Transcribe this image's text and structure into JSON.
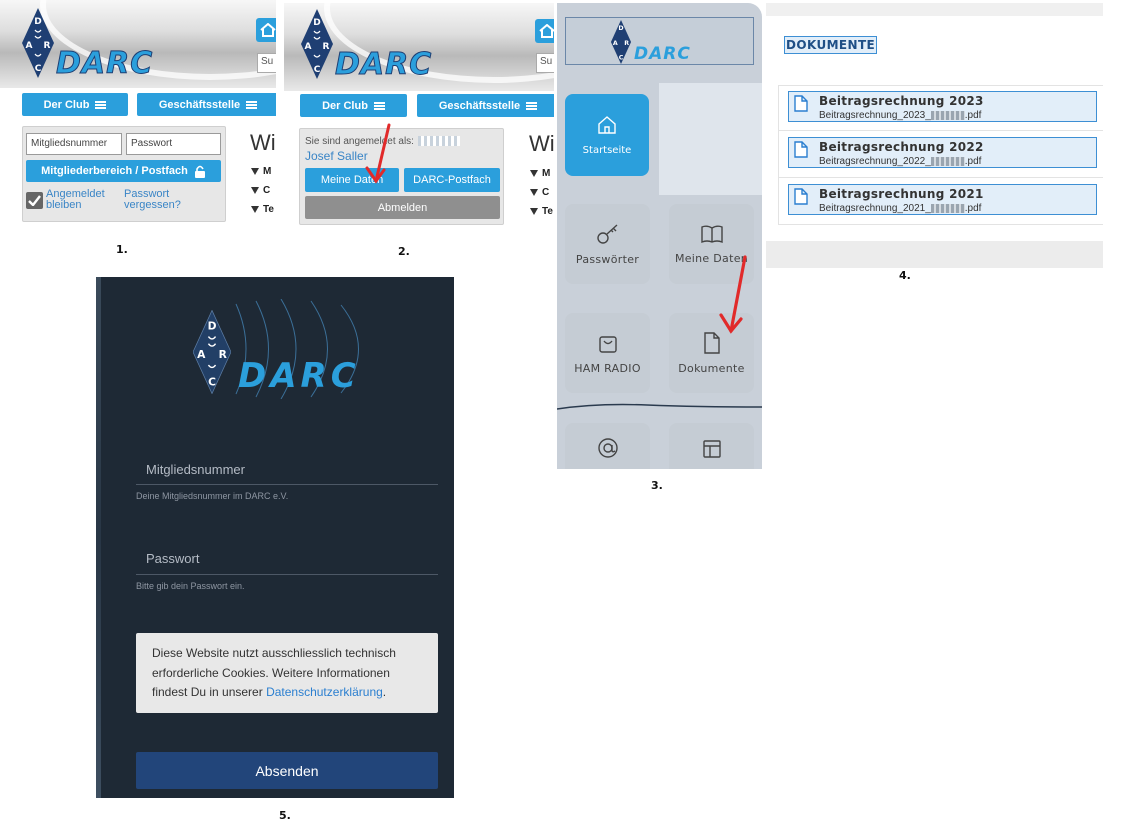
{
  "brand": {
    "logo_text": "DARC",
    "logo_letters": [
      "D",
      "A",
      "R",
      "C"
    ],
    "accent_color": "#2b9fdc"
  },
  "step_labels": [
    "1.",
    "2.",
    "3.",
    "4.",
    "5."
  ],
  "panel1": {
    "nav": {
      "club": "Der Club",
      "office": "Geschäftsstelle"
    },
    "search_partial": "Su",
    "member_number_placeholder": "Mitgliedsnummer",
    "password_placeholder": "Passwort",
    "login_button": "Mitgliederbereich / Postfach",
    "stay_logged_in_line1": "Angemeldet",
    "stay_logged_in_line2": "bleiben",
    "forgot_line1": "Passwort",
    "forgot_line2": "vergessen?",
    "heading_partial": "Wi",
    "menu_partial": [
      "M",
      "C",
      "Te"
    ]
  },
  "panel2": {
    "nav": {
      "club": "Der Club",
      "office": "Geschäftsstelle"
    },
    "search_partial": "Su",
    "logged_in_as": "Sie sind angemeldet als:",
    "user_name": "Josef Saller",
    "my_data_button": "Meine Daten",
    "mailbox_button": "DARC-Postfach",
    "logout_button": "Abmelden",
    "heading_partial": "Wi",
    "menu_partial": [
      "M",
      "C",
      "Te"
    ]
  },
  "panel3": {
    "home_tile": "Startseite",
    "tiles": [
      "Passwörter",
      "Meine Daten",
      "HAM RADIO",
      "Dokumente"
    ]
  },
  "panel4": {
    "section_title": "DOKUMENTE",
    "documents": [
      {
        "title": "Beitragsrechnung 2023",
        "file_prefix": "Beitragsrechnung_2023_",
        "file_ext": ".pdf"
      },
      {
        "title": "Beitragsrechnung 2022",
        "file_prefix": "Beitragsrechnung_2022_",
        "file_ext": ".pdf"
      },
      {
        "title": "Beitragsrechnung 2021",
        "file_prefix": "Beitragsrechnung_2021_",
        "file_ext": ".pdf"
      }
    ]
  },
  "panel5": {
    "member_number_label": "Mitgliedsnummer",
    "member_number_hint": "Deine Mitgliedsnummer im DARC e.V.",
    "password_label": "Passwort",
    "password_hint": "Bitte gib dein Passwort ein.",
    "cookie_text": "Diese Website nutzt ausschliesslich technisch erforderliche Cookies. Weitere Informationen findest Du in unserer ",
    "cookie_link": "Datenschutzerklärung",
    "cookie_end": ".",
    "submit_button": "Absenden"
  }
}
